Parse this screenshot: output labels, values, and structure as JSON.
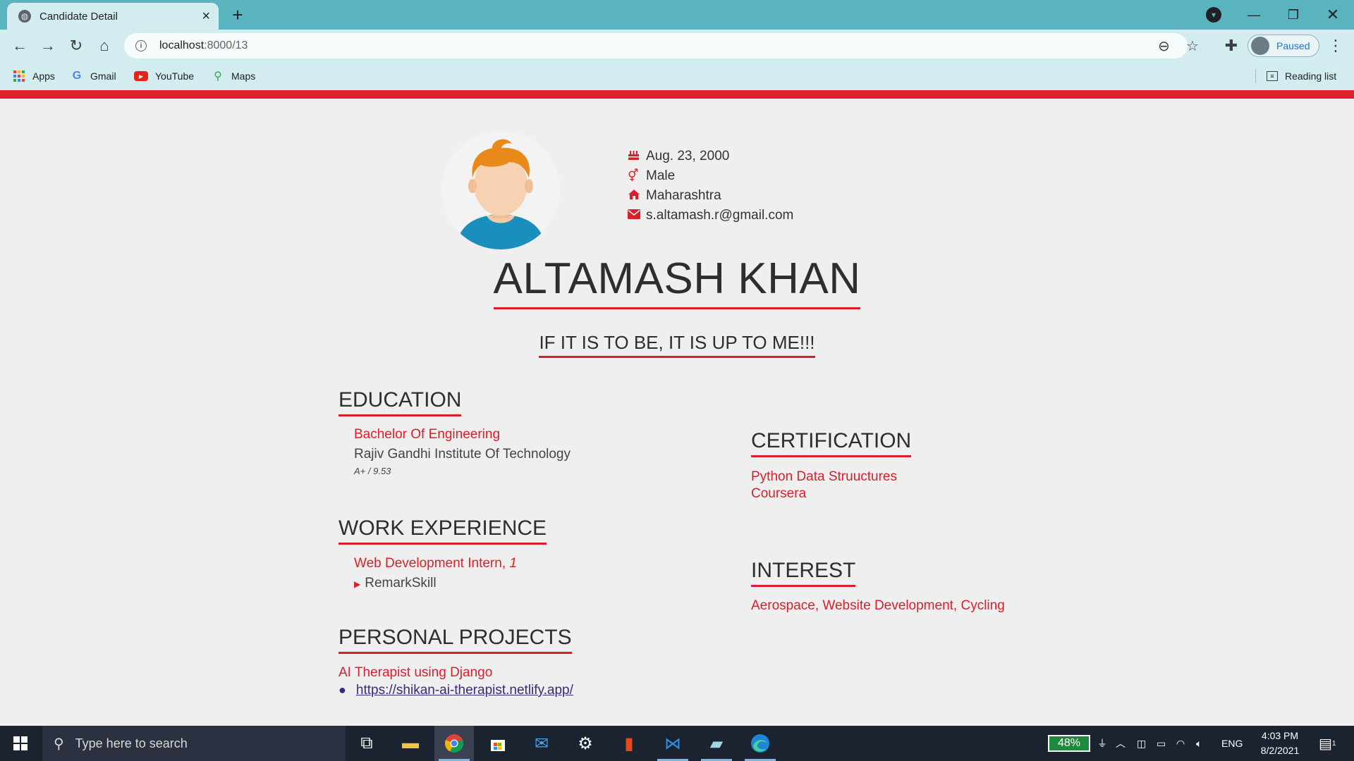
{
  "browser": {
    "tab_title": "Candidate Detail",
    "url_host": "localhost",
    "url_rest": ":8000/13",
    "profile_label": "Paused",
    "bookmarks": [
      {
        "label": "Apps"
      },
      {
        "label": "Gmail"
      },
      {
        "label": "YouTube"
      },
      {
        "label": "Maps"
      }
    ],
    "reading_list": "Reading list"
  },
  "colors": {
    "accent": "#d81f2a",
    "tabbar": "#5ab4bf",
    "toolbar": "#d3ecef",
    "page_bg": "#efefef",
    "taskbar": "#1b2230"
  },
  "profile": {
    "dob": "Aug. 23, 2000",
    "gender": "Male",
    "state": "Maharashtra",
    "email": "s.altamash.r@gmail.com",
    "name": "ALTAMASH KHAN",
    "motto": "IF IT IS TO BE, IT IS UP TO ME!!!"
  },
  "education": {
    "title": "EDUCATION",
    "degree": "Bachelor Of Engineering",
    "institute": "Rajiv Gandhi Institute Of Technology",
    "grade": "A+ / 9.53"
  },
  "work": {
    "title": "WORK EXPERIENCE",
    "role": "Web Development Intern,",
    "duration": "1",
    "company": "RemarkSkill"
  },
  "projects": {
    "title": "PERSONAL PROJECTS",
    "name": "AI Therapist using Django",
    "link": "https://shikan-ai-therapist.netlify.app/"
  },
  "certification": {
    "title": "CERTIFICATION",
    "course": "Python Data Struuctures",
    "provider": "Coursera"
  },
  "interest": {
    "title": "INTEREST",
    "items": "Aerospace, Website Development, Cycling"
  },
  "taskbar": {
    "search_placeholder": "Type here to search",
    "battery": "48%",
    "lang": "ENG",
    "time": "4:03 PM",
    "date": "8/2/2021",
    "notif_count": "1"
  }
}
